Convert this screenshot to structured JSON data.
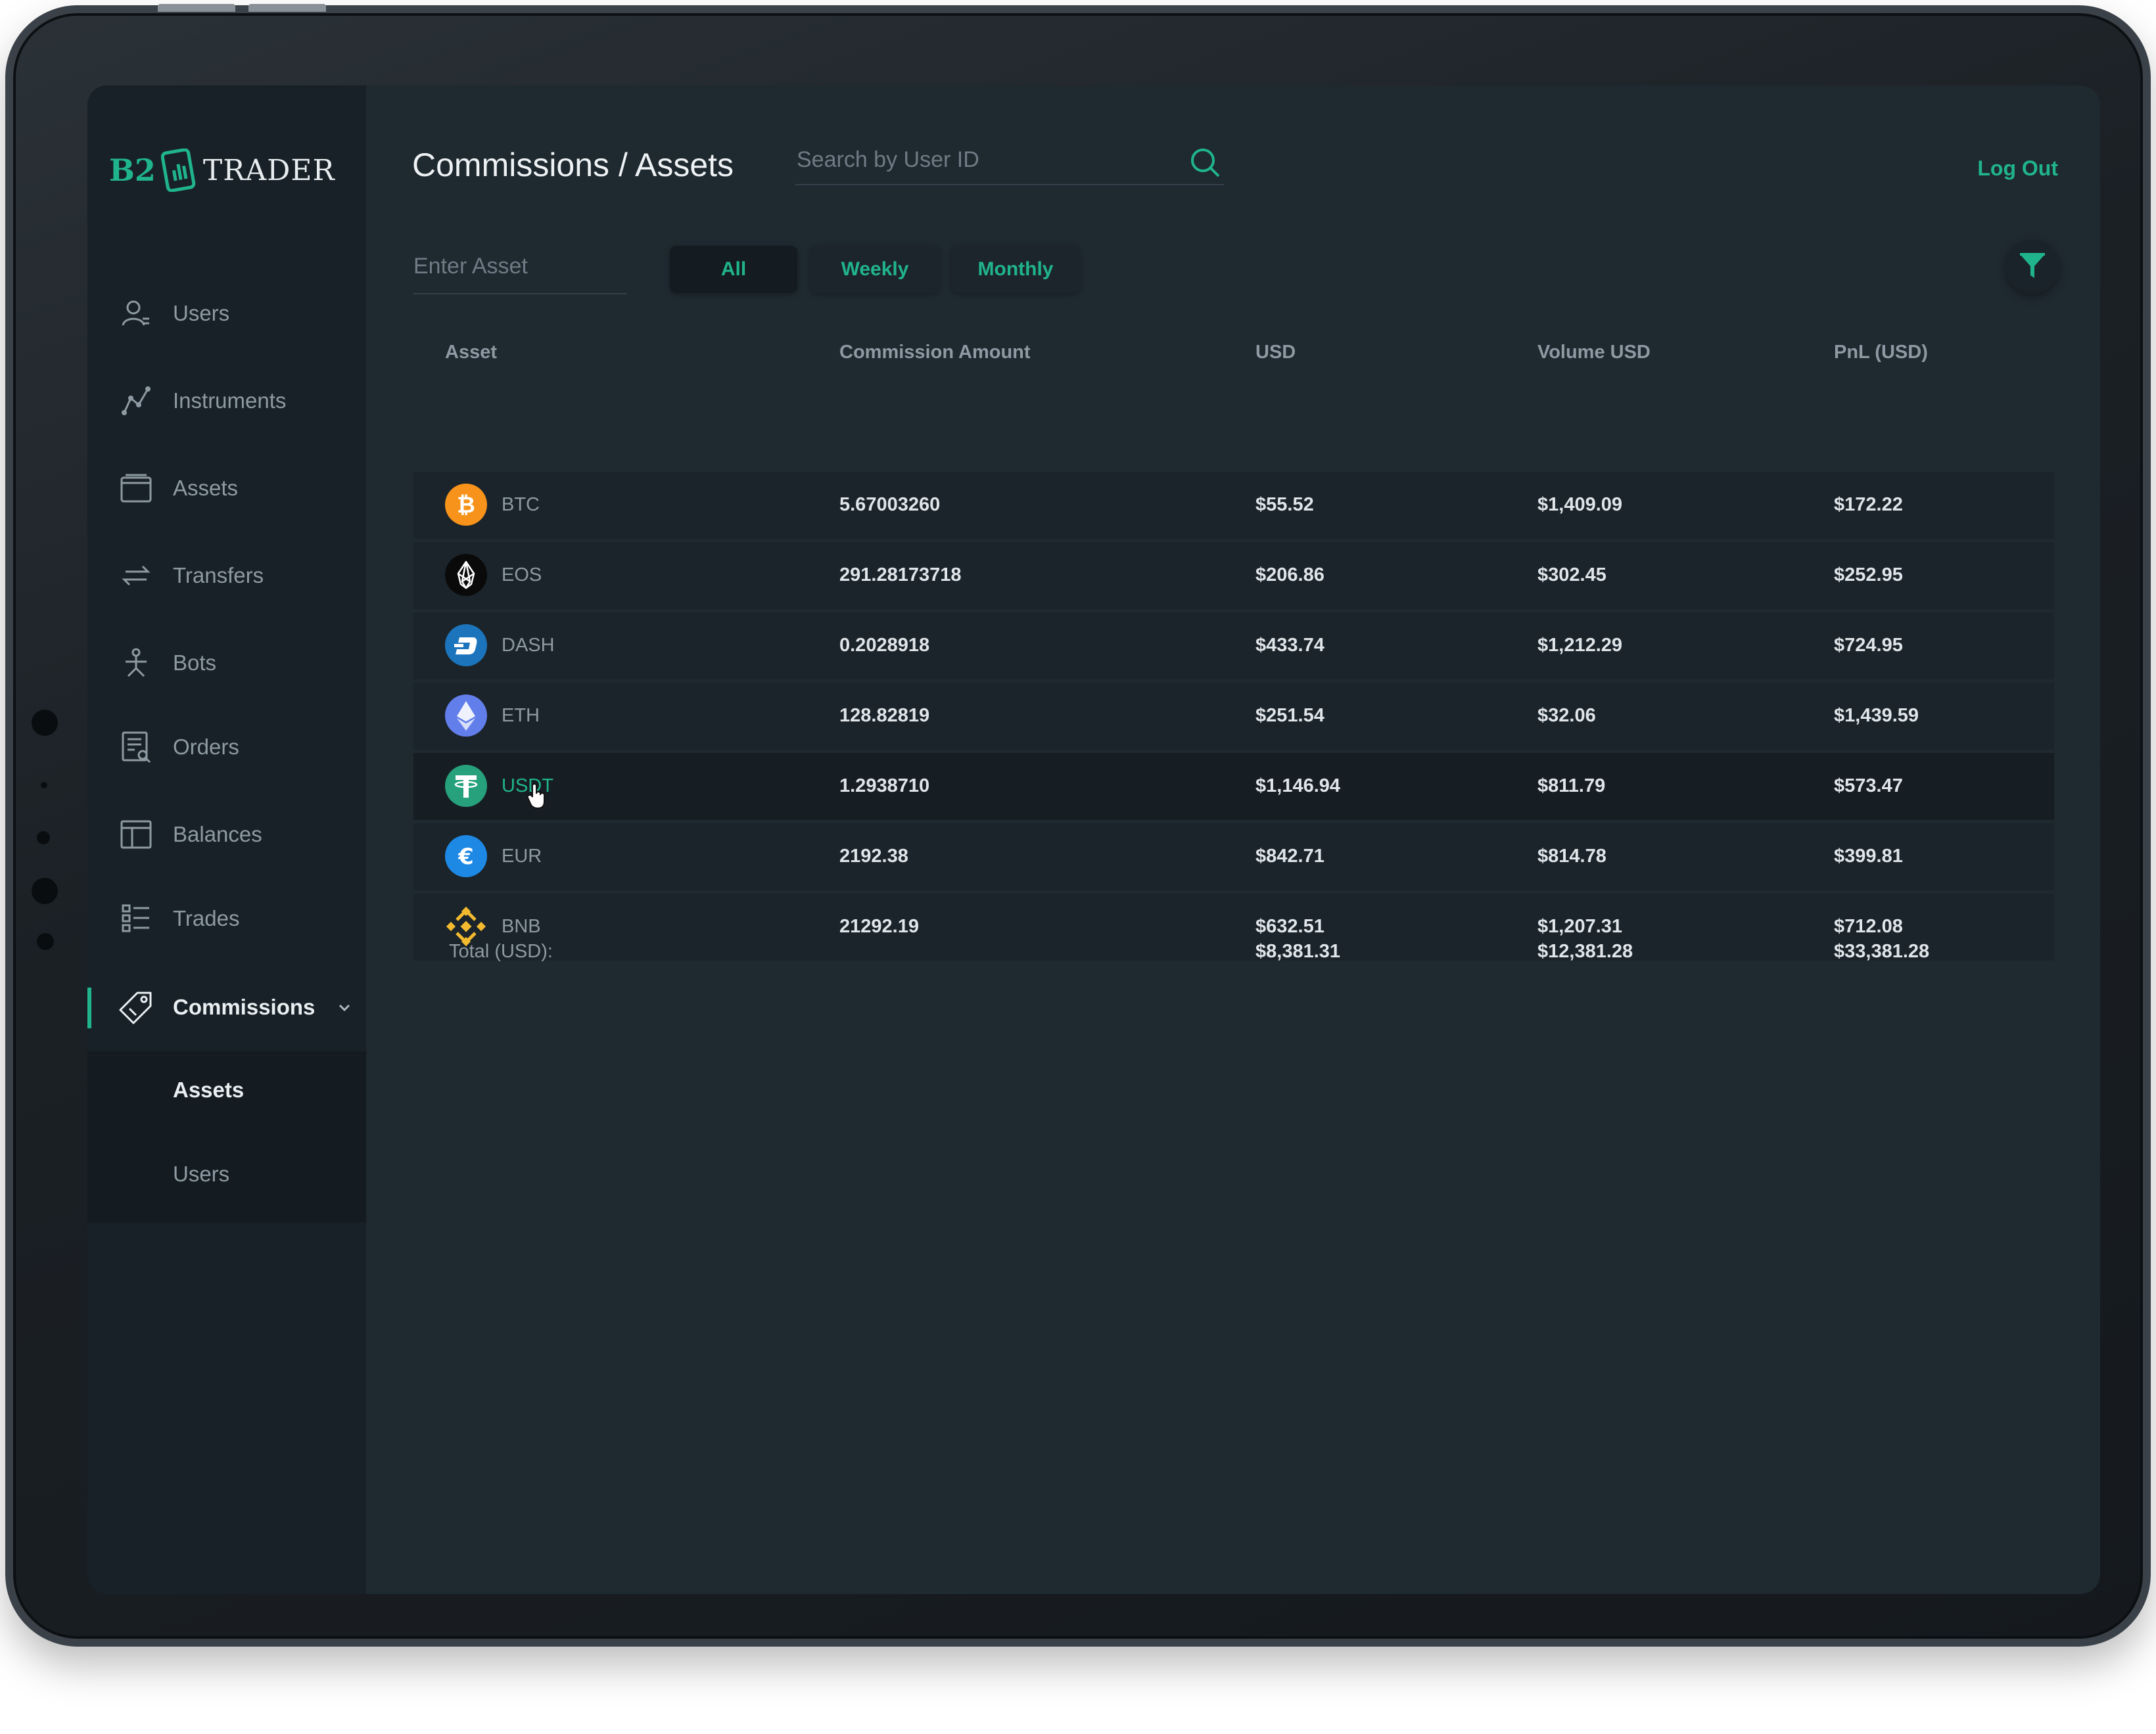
{
  "brand": {
    "left": "B2",
    "right": "TRADER"
  },
  "sidebar": {
    "items": [
      {
        "label": "Users",
        "icon": "user-icon"
      },
      {
        "label": "Instruments",
        "icon": "instruments-icon"
      },
      {
        "label": "Assets",
        "icon": "wallet-icon"
      },
      {
        "label": "Transfers",
        "icon": "transfer-arrows-icon"
      },
      {
        "label": "Bots",
        "icon": "bot-icon"
      },
      {
        "label": "Orders",
        "icon": "orders-icon"
      },
      {
        "label": "Balances",
        "icon": "balances-icon"
      },
      {
        "label": "Trades",
        "icon": "trades-list-icon"
      },
      {
        "label": "Commissions",
        "icon": "tag-icon",
        "active": true
      }
    ],
    "submenu": [
      {
        "label": "Assets",
        "active": true
      },
      {
        "label": "Users"
      }
    ]
  },
  "header": {
    "title": "Commissions / Assets",
    "search_placeholder": "Search by User ID",
    "logout_label": "Log Out"
  },
  "filters": {
    "asset_placeholder": "Enter Asset",
    "tabs": [
      {
        "label": "All",
        "active": true
      },
      {
        "label": "Weekly"
      },
      {
        "label": "Monthly"
      }
    ]
  },
  "table": {
    "columns": [
      "Asset",
      "Commission Amount",
      "USD",
      "Volume USD",
      "PnL (USD)"
    ],
    "rows": [
      {
        "asset": "BTC",
        "amount": "5.67003260",
        "usd": "$55.52",
        "volume": "$1,409.09",
        "pnl": "$172.22",
        "color": "#f7931a"
      },
      {
        "asset": "EOS",
        "amount": "291.28173718",
        "usd": "$206.86",
        "volume": "$302.45",
        "pnl": "$252.95",
        "color": "#000000"
      },
      {
        "asset": "DASH",
        "amount": "0.2028918",
        "usd": "$433.74",
        "volume": "$1,212.29",
        "pnl": "$724.95",
        "color": "#1c75bc"
      },
      {
        "asset": "ETH",
        "amount": "128.82819",
        "usd": "$251.54",
        "volume": "$32.06",
        "pnl": "$1,439.59",
        "color": "#627eea"
      },
      {
        "asset": "USDT",
        "amount": "1.2938710",
        "usd": "$1,146.94",
        "volume": "$811.79",
        "pnl": "$573.47",
        "color": "#26a17b",
        "hover": true
      },
      {
        "asset": "EUR",
        "amount": "2192.38",
        "usd": "$842.71",
        "volume": "$814.78",
        "pnl": "$399.81",
        "color": "#1e88e5"
      },
      {
        "asset": "BNB",
        "amount": "21292.19",
        "usd": "$632.51",
        "volume": "$1,207.31",
        "pnl": "$712.08",
        "color": "#f3ba2f"
      }
    ],
    "total": {
      "label": "Total (USD):",
      "usd": "$8,381.31",
      "volume": "$12,381.28",
      "pnl": "$33,381.28"
    }
  },
  "colors": {
    "accent": "#20b48c",
    "background": "#1f2930",
    "sidebar": "#182127"
  }
}
